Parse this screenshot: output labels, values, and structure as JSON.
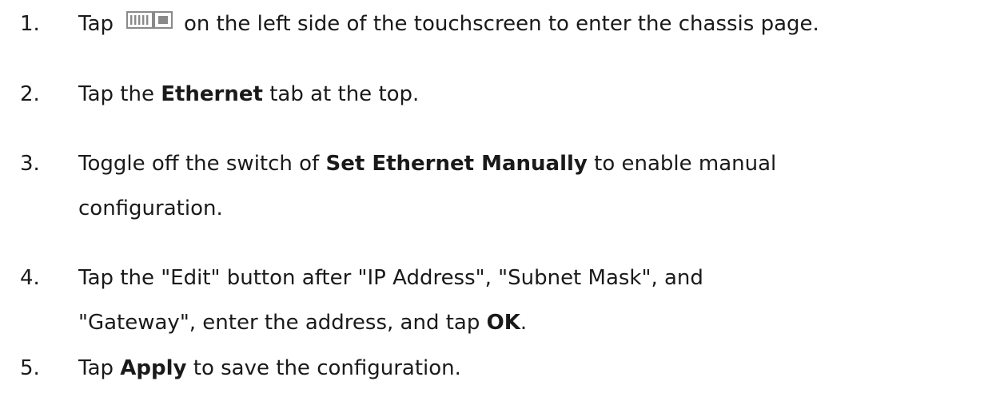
{
  "steps": [
    {
      "number": "1.",
      "before_icon": "Tap",
      "icon": "chassis-icon",
      "after_icon": "on the left side of the touchscreen to enter the chassis page."
    },
    {
      "number": "2.",
      "pre": "Tap the",
      "bold": "Ethernet",
      "post": "tab at the top."
    },
    {
      "number": "3.",
      "pre": "Toggle off the switch of",
      "bold": "Set Ethernet Manually",
      "post": "to enable manual",
      "line2": "configuration."
    },
    {
      "number": "4.",
      "line1": "Tap the \"Edit\" button after \"IP Address\", \"Subnet Mask\", and",
      "line2_pre": "\"Gateway\", enter the address, and tap",
      "bold": "OK",
      "post": "."
    },
    {
      "number": "5.",
      "pre": "Tap",
      "bold": "Apply",
      "post": "to save the configuration."
    }
  ],
  "colors": {
    "text": "#1a1a1a",
    "icon": "#8a8a8a"
  }
}
